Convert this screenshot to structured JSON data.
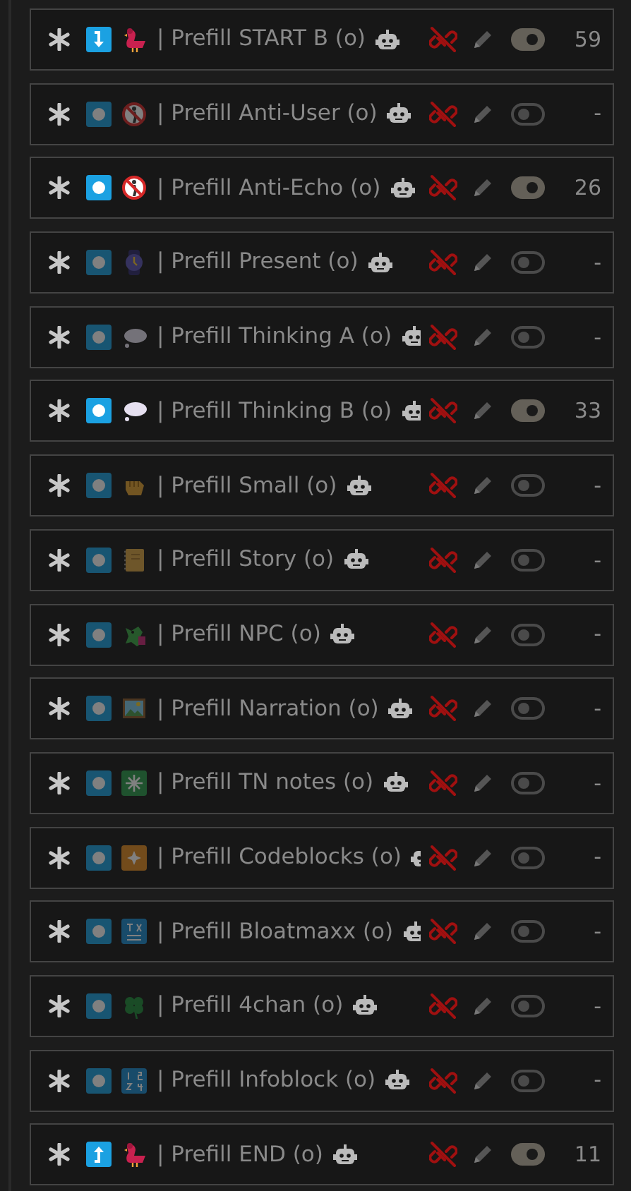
{
  "prompts": [
    {
      "badge": {
        "kind": "arrow-down"
      },
      "emoji": {
        "kind": "bird"
      },
      "name": "| Prefill START B (o)",
      "enabled": true,
      "count": "59"
    },
    {
      "badge": {
        "kind": "dot"
      },
      "emoji": {
        "kind": "nowalking"
      },
      "name": "| Prefill Anti-User (o)",
      "enabled": false,
      "count": "-"
    },
    {
      "badge": {
        "kind": "dot"
      },
      "emoji": {
        "kind": "nowalking"
      },
      "name": "| Prefill Anti-Echo (o)",
      "enabled": true,
      "count": "26"
    },
    {
      "badge": {
        "kind": "dot"
      },
      "emoji": {
        "kind": "watch"
      },
      "name": "| Prefill Present (o)",
      "enabled": false,
      "count": "-"
    },
    {
      "badge": {
        "kind": "dot"
      },
      "emoji": {
        "kind": "cloud"
      },
      "name": "| Prefill Thinking A (o)",
      "enabled": false,
      "count": "-"
    },
    {
      "badge": {
        "kind": "dot"
      },
      "emoji": {
        "kind": "cloud"
      },
      "name": "| Prefill Thinking B (o)",
      "enabled": true,
      "count": "33"
    },
    {
      "badge": {
        "kind": "dot"
      },
      "emoji": {
        "kind": "fist"
      },
      "name": "| Prefill Small (o)",
      "enabled": false,
      "count": "-"
    },
    {
      "badge": {
        "kind": "dot"
      },
      "emoji": {
        "kind": "notebook"
      },
      "name": "| Prefill Story (o)",
      "enabled": false,
      "count": "-"
    },
    {
      "badge": {
        "kind": "dot"
      },
      "emoji": {
        "kind": "dragon"
      },
      "name": "| Prefill NPC (o)",
      "enabled": false,
      "count": "-"
    },
    {
      "badge": {
        "kind": "dot"
      },
      "emoji": {
        "kind": "landscape"
      },
      "name": "| Prefill Narration (o)",
      "enabled": false,
      "count": "-"
    },
    {
      "badge": {
        "kind": "dot"
      },
      "emoji": {
        "kind": "greenstar"
      },
      "name": "| Prefill TN notes (o)",
      "enabled": false,
      "count": "-"
    },
    {
      "badge": {
        "kind": "dot"
      },
      "emoji": {
        "kind": "orangestar"
      },
      "name": "| Prefill Codeblocks (o)",
      "enabled": false,
      "count": "-"
    },
    {
      "badge": {
        "kind": "dot"
      },
      "emoji": {
        "kind": "symbols"
      },
      "name": "| Prefill Bloatmaxx (o)",
      "enabled": false,
      "count": "-"
    },
    {
      "badge": {
        "kind": "dot"
      },
      "emoji": {
        "kind": "clover"
      },
      "name": "| Prefill 4chan (o)",
      "enabled": false,
      "count": "-"
    },
    {
      "badge": {
        "kind": "dot"
      },
      "emoji": {
        "kind": "numbers"
      },
      "name": "| Prefill Infoblock (o)",
      "enabled": false,
      "count": "-"
    },
    {
      "badge": {
        "kind": "arrow-up"
      },
      "emoji": {
        "kind": "bird"
      },
      "name": "| Prefill END (o)",
      "enabled": true,
      "count": "11"
    }
  ]
}
